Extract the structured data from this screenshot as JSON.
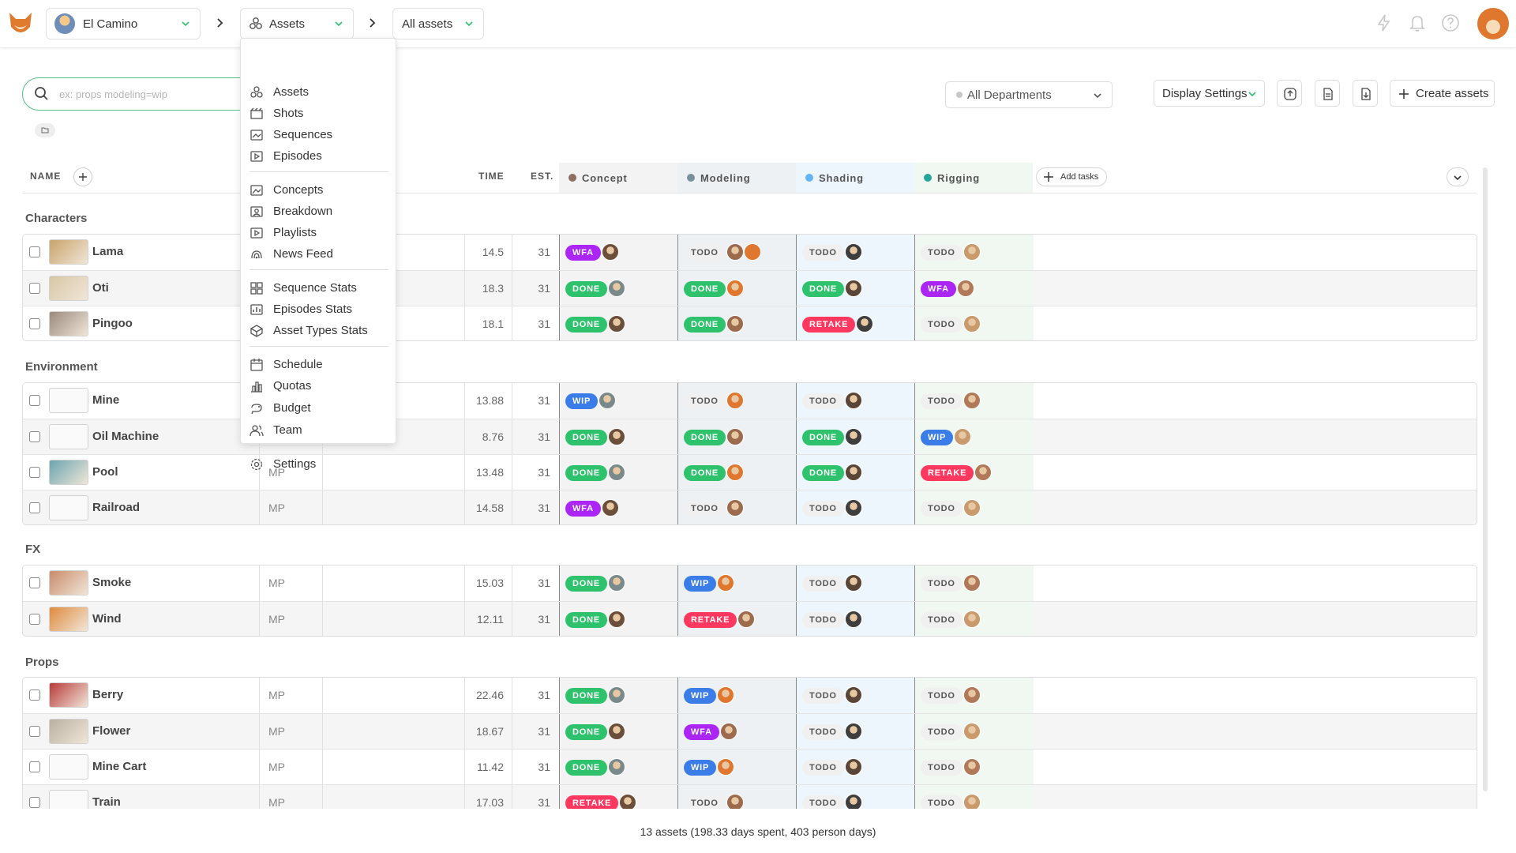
{
  "topbar": {
    "project": "El Camino",
    "section": "Assets",
    "filter": "All assets"
  },
  "search": {
    "placeholder": "ex: props modeling=wip",
    "value": ""
  },
  "toolbar": {
    "departments": "All Departments",
    "display_settings": "Display Settings",
    "create_assets": "Create assets"
  },
  "menu": {
    "items": [
      {
        "label": "Assets",
        "icon": "assets-icon"
      },
      {
        "label": "Shots",
        "icon": "shots-icon"
      },
      {
        "label": "Sequences",
        "icon": "sequences-icon"
      },
      {
        "label": "Episodes",
        "icon": "episodes-icon"
      },
      {
        "label": "Concepts",
        "icon": "concepts-icon"
      },
      {
        "label": "Breakdown",
        "icon": "breakdown-icon"
      },
      {
        "label": "Playlists",
        "icon": "playlists-icon"
      },
      {
        "label": "News Feed",
        "icon": "news-feed-icon"
      },
      {
        "label": "Sequence Stats",
        "icon": "sequence-stats-icon"
      },
      {
        "label": "Episodes Stats",
        "icon": "episodes-stats-icon"
      },
      {
        "label": "Asset Types Stats",
        "icon": "asset-types-stats-icon"
      },
      {
        "label": "Schedule",
        "icon": "schedule-icon"
      },
      {
        "label": "Quotas",
        "icon": "quotas-icon"
      },
      {
        "label": "Budget",
        "icon": "budget-icon"
      },
      {
        "label": "Team",
        "icon": "team-icon"
      },
      {
        "label": "Settings",
        "icon": "settings-icon"
      }
    ]
  },
  "table": {
    "headers": {
      "name": "NAME",
      "time": "TIME",
      "est": "EST.",
      "add_tasks": "Add tasks"
    },
    "task_types": [
      {
        "name": "Concept",
        "color": "#8d6e63",
        "bg": "#f3f3f3"
      },
      {
        "name": "Modeling",
        "color": "#78909c",
        "bg": "#eef1f4"
      },
      {
        "name": "Shading",
        "color": "#64b5f6",
        "bg": "#eef6fd"
      },
      {
        "name": "Rigging",
        "color": "#26a69a",
        "bg": "#f1f8f1"
      }
    ],
    "groups": [
      {
        "title": "Characters",
        "rows": [
          {
            "name": "Lama",
            "mp": "",
            "time": "14.5",
            "est": "31",
            "thumb": "#c9a36a",
            "tasks": [
              "WFA",
              "TODO",
              "TODO",
              "TODO"
            ]
          },
          {
            "name": "Oti",
            "mp": "",
            "time": "18.3",
            "est": "31",
            "thumb": "#d8c7a6",
            "tasks": [
              "DONE",
              "DONE",
              "DONE",
              "WFA"
            ]
          },
          {
            "name": "Pingoo",
            "mp": "",
            "time": "18.1",
            "est": "31",
            "thumb": "#9a8a7c",
            "tasks": [
              "DONE",
              "DONE",
              "RETAKE",
              "TODO"
            ]
          }
        ]
      },
      {
        "title": "Environment",
        "rows": [
          {
            "name": "Mine",
            "mp": "",
            "time": "13.88",
            "est": "31",
            "thumb": "",
            "tasks": [
              "WIP",
              "TODO",
              "TODO",
              "TODO"
            ]
          },
          {
            "name": "Oil Machine",
            "mp": "",
            "time": "8.76",
            "est": "31",
            "thumb": "",
            "tasks": [
              "DONE",
              "DONE",
              "DONE",
              "WIP"
            ]
          },
          {
            "name": "Pool",
            "mp": "MP",
            "time": "13.48",
            "est": "31",
            "thumb": "#6aa5b0",
            "tasks": [
              "DONE",
              "DONE",
              "DONE",
              "RETAKE"
            ]
          },
          {
            "name": "Railroad",
            "mp": "MP",
            "time": "14.58",
            "est": "31",
            "thumb": "",
            "tasks": [
              "WFA",
              "TODO",
              "TODO",
              "TODO"
            ]
          }
        ]
      },
      {
        "title": "FX",
        "rows": [
          {
            "name": "Smoke",
            "mp": "MP",
            "time": "15.03",
            "est": "31",
            "thumb": "#c98b6a",
            "tasks": [
              "DONE",
              "WIP",
              "TODO",
              "TODO"
            ]
          },
          {
            "name": "Wind",
            "mp": "MP",
            "time": "12.11",
            "est": "31",
            "thumb": "#e08a3c",
            "tasks": [
              "DONE",
              "RETAKE",
              "TODO",
              "TODO"
            ]
          }
        ]
      },
      {
        "title": "Props",
        "rows": [
          {
            "name": "Berry",
            "mp": "MP",
            "time": "22.46",
            "est": "31",
            "thumb": "#b83a3a",
            "tasks": [
              "DONE",
              "WIP",
              "TODO",
              "TODO"
            ]
          },
          {
            "name": "Flower",
            "mp": "MP",
            "time": "18.67",
            "est": "31",
            "thumb": "#b9b0a0",
            "tasks": [
              "DONE",
              "WFA",
              "TODO",
              "TODO"
            ]
          },
          {
            "name": "Mine Cart",
            "mp": "MP",
            "time": "11.42",
            "est": "31",
            "thumb": "",
            "tasks": [
              "DONE",
              "WIP",
              "TODO",
              "TODO"
            ]
          },
          {
            "name": "Train",
            "mp": "MP",
            "time": "17.03",
            "est": "31",
            "thumb": "",
            "tasks": [
              "RETAKE",
              "TODO",
              "TODO",
              "TODO"
            ]
          }
        ]
      }
    ]
  },
  "footer": {
    "summary": "13 assets (198.33 days spent, 403 person days)"
  }
}
